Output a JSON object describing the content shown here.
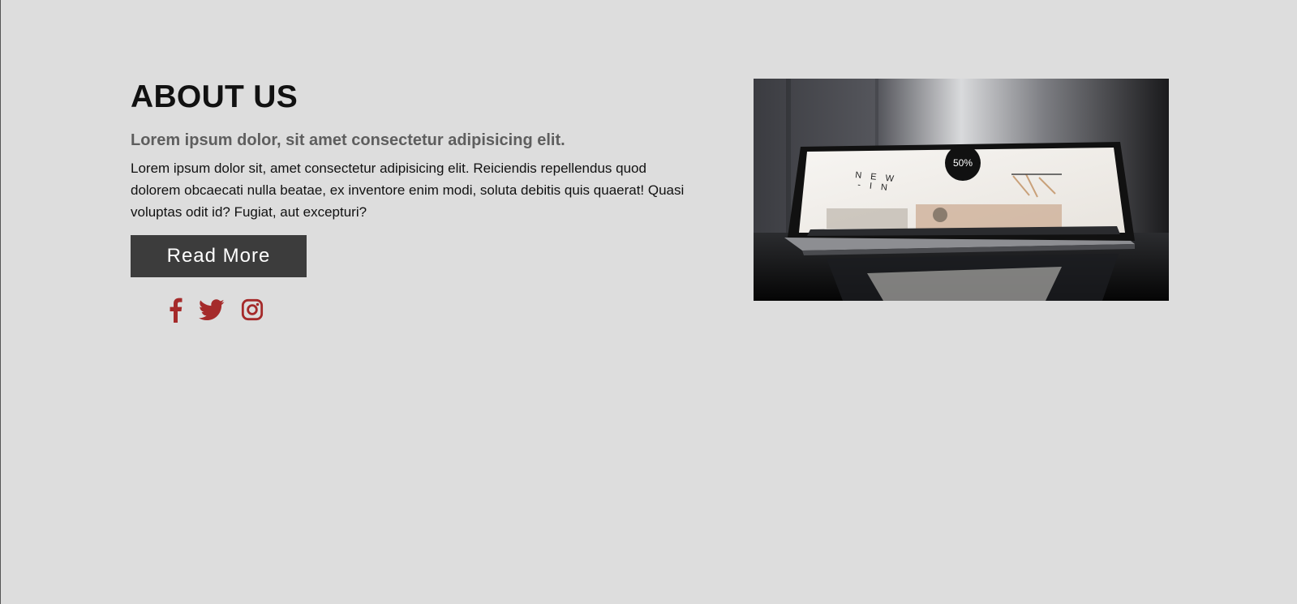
{
  "about": {
    "title": "ABOUT US",
    "subtitle": "Lorem ipsum dolor, sit amet consectetur adipisicing elit.",
    "body": "Lorem ipsum dolor sit, amet consectetur adipisicing elit. Reiciendis repellendus quod dolorem obcaecati nulla beatae, ex inventore enim modi, soluta debitis quis quaerat! Quasi voluptas odit id? Fugiat, aut excepturi?",
    "button_label": "Read More"
  },
  "social": {
    "icons": [
      "facebook-icon",
      "twitter-icon",
      "instagram-icon"
    ],
    "color": "#a52a2a"
  },
  "image": {
    "subject": "laptop-photo",
    "screen_text": "NEW - IN",
    "badge_text": "50%"
  },
  "colors": {
    "background": "#dddddd",
    "button_bg": "#3c3c3c",
    "subtitle": "#5e5e5e"
  }
}
